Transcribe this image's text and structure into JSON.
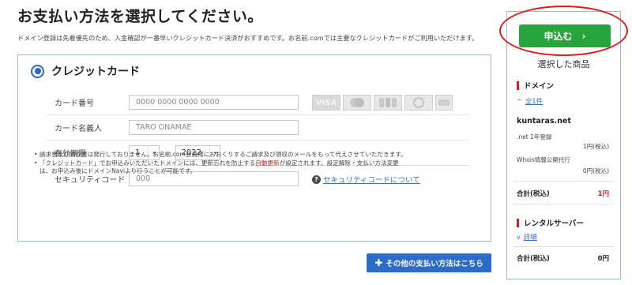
{
  "page": {
    "title": "お支払い方法を選択してください。",
    "subtitle": "ドメイン登録は先着優先のため、入金確認が一番早いクレジットカード決済がおすすめです。お名前.comでは主要なクレジットカードがご利用いただけます。"
  },
  "credit_card": {
    "label": "クレジットカード",
    "card_number_label": "カード番号",
    "card_number_placeholder": "0000 0000 0000 0000",
    "card_name_label": "カード名義人",
    "card_name_placeholder": "TARO ONAMAE",
    "expiry_label": "有効期限",
    "expiry_month": "1",
    "expiry_year": "2022",
    "expiry_separator": "-",
    "security_label": "セキュリティコード",
    "security_placeholder": "000",
    "security_help": "セキュリティコードについて",
    "card_logos": [
      "VISA",
      "MasterCard",
      "JCB",
      "Diners",
      "AMEX"
    ]
  },
  "notes": {
    "line1": "請求書及び領収書は発行しておりません。お名前.com会員様におおくりするご請求及び領収のメールをもって代えさせていただきます。",
    "line2_pre": "「クレジットカード」でお申込みいただいたドメインには、更新忘れを防止する",
    "line2_red": "自動更新",
    "line2_post": "が設定されます。設定解除・支払い方法変更",
    "line3": "は、お申込み後にドメインNaviより行うことが可能です。"
  },
  "other_payment_button": "その他の支払い方法はこちら",
  "sidebar": {
    "apply_button": "申込む",
    "selected_title": "選択した商品",
    "domain_section": {
      "heading": "ドメイン",
      "toggle": "全1件",
      "domain": "kuntaras.net",
      "items": [
        {
          "name": ".net 1年登録",
          "price": "1円(税込)"
        },
        {
          "name": "Whois情報公開代行",
          "price": "0円(税込)"
        }
      ],
      "total_label": "合計(税込)",
      "total_value": "1円"
    },
    "server_section": {
      "heading": "レンタルサーバー",
      "toggle": "詳細",
      "total_label": "合計(税込)",
      "total_value": "0円"
    }
  },
  "colors": {
    "accent_blue": "#2c6bc7",
    "apply_green": "#26a53e",
    "highlight_red": "#e11b1b"
  }
}
